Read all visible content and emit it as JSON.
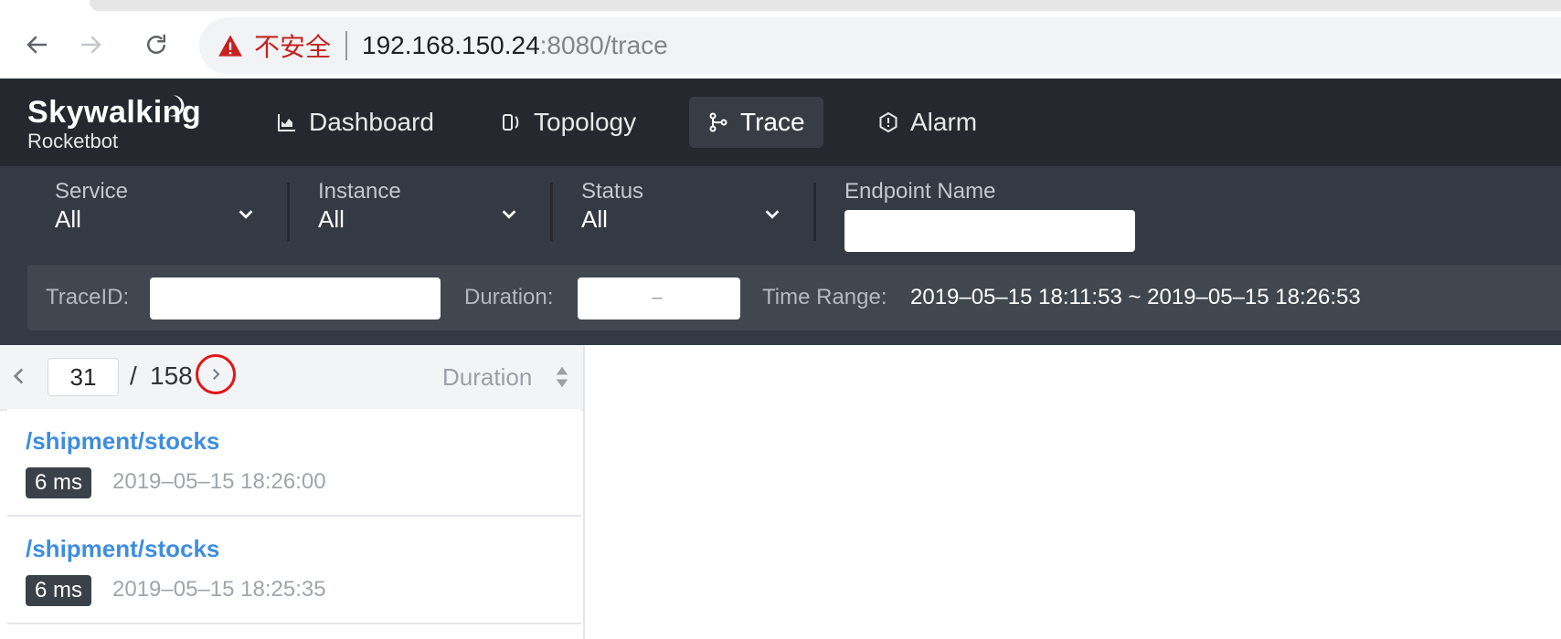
{
  "browser": {
    "insecure_label": "不安全",
    "url_host": "192.168.150.24",
    "url_rest": ":8080/trace"
  },
  "app": {
    "logo_text": "Skywalking",
    "logo_subtitle": "Rocketbot",
    "nav": [
      {
        "label": "Dashboard",
        "icon": "chart-icon"
      },
      {
        "label": "Topology",
        "icon": "topology-icon"
      },
      {
        "label": "Trace",
        "icon": "branch-icon",
        "active": true
      },
      {
        "label": "Alarm",
        "icon": "alarm-icon"
      }
    ]
  },
  "filters": {
    "service": {
      "label": "Service",
      "value": "All"
    },
    "instance": {
      "label": "Instance",
      "value": "All"
    },
    "status": {
      "label": "Status",
      "value": "All"
    },
    "endpoint": {
      "label": "Endpoint Name",
      "value": ""
    },
    "trace_id": {
      "label": "TraceID:",
      "value": ""
    },
    "duration": {
      "label": "Duration:",
      "separator": "–"
    },
    "time_range": {
      "label": "Time Range:",
      "value": "2019–05–15 18:11:53 ~ 2019–05–15 18:26:53"
    }
  },
  "pager": {
    "current": "31",
    "separator": "/",
    "total": "158",
    "sort_label": "Duration"
  },
  "traces": [
    {
      "endpoint": "/shipment/stocks",
      "duration": "6 ms",
      "time": "2019–05–15 18:26:00"
    },
    {
      "endpoint": "/shipment/stocks",
      "duration": "6 ms",
      "time": "2019–05–15 18:25:35"
    }
  ],
  "colors": {
    "header_bg": "#25292f",
    "filter_bg": "#343a43",
    "link": "#3e8ddf",
    "highlight_circle": "#e01717"
  }
}
